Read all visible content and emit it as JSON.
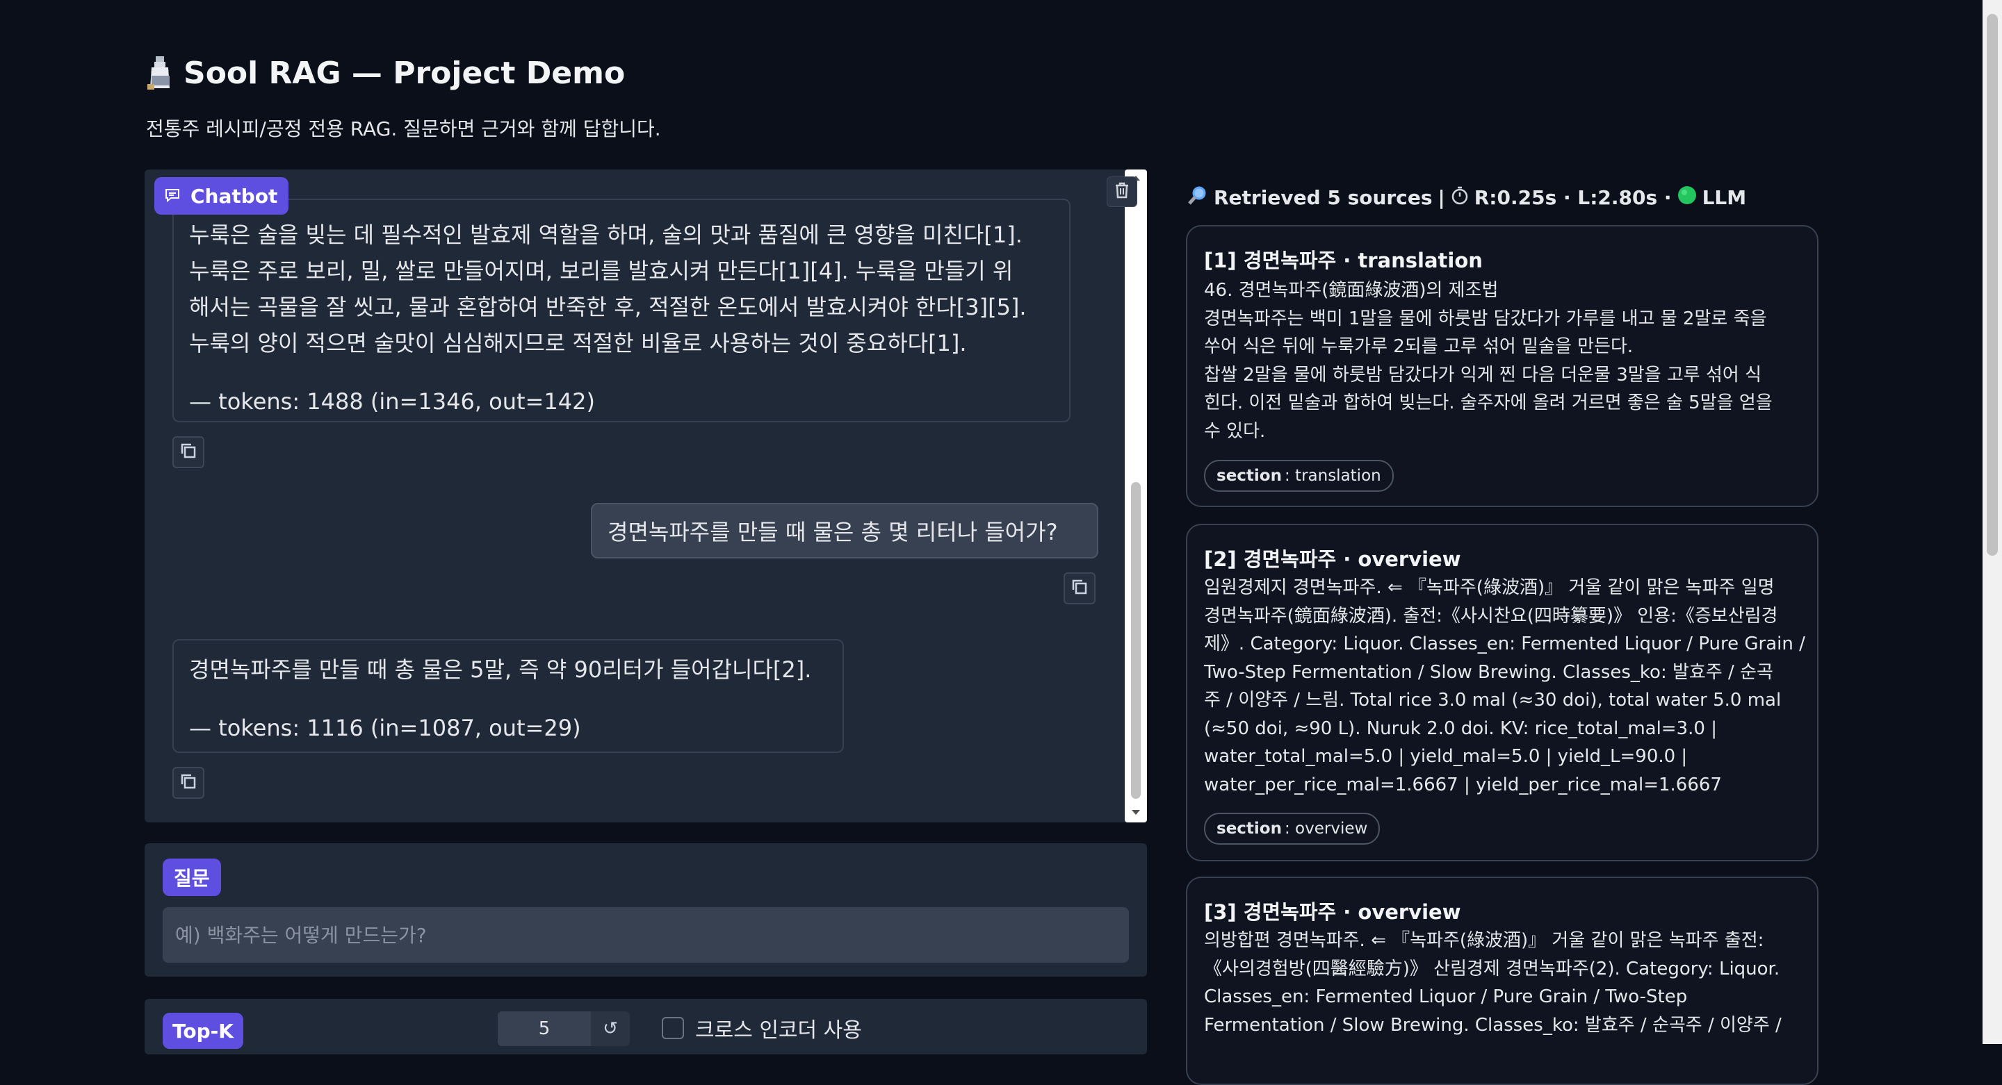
{
  "header": {
    "title": "Sool RAG — Project Demo",
    "subtitle": "전통주 레시피/공정 전용 RAG. 질문하면 근거와 함께 답합니다."
  },
  "chat": {
    "label": "Chatbot",
    "messages": [
      {
        "role": "assistant",
        "lines": [
          "누룩은 술을 빚는 데 필수적인 발효제 역할을 하며, 술의 맛과 품질에 큰 영향을 미친다[1].",
          "누룩은 주로 보리, 밀, 쌀로 만들어지며, 보리를 발효시켜 만든다[1][4]. 누룩을 만들기 위",
          "해서는 곡물을 잘 씻고, 물과 혼합하여 반죽한 후, 적절한 온도에서 발효시켜야 한다[3][5].",
          "누룩의 양이 적으면 술맛이 심심해지므로 적절한 비율로 사용하는 것이 중요하다[1]."
        ],
        "tokens": "— tokens: 1488 (in=1346, out=142)"
      },
      {
        "role": "user",
        "text": "경면녹파주를 만들 때 물은 총 몇 리터나 들어가?"
      },
      {
        "role": "assistant",
        "lines": [
          "경면녹파주를 만들 때 총 물은 5말, 즉 약 90리터가 들어갑니다[2]."
        ],
        "tokens": "— tokens: 1116 (in=1087, out=29)"
      }
    ]
  },
  "question": {
    "label": "질문",
    "placeholder": "예) 백화주는 어떻게 만드는가?"
  },
  "topk": {
    "label": "Top-K",
    "value": "5",
    "reset_icon": "↺",
    "cross_encoder_label": "크로스 인코더 사용"
  },
  "sources": {
    "header_main": "Retrieved 5 sources",
    "header_sep": "|",
    "header_timing": "R:0.25s · L:2.80s ·",
    "header_llm": "LLM",
    "status_color": "#22c55e",
    "cards": [
      {
        "title": "[1] 경면녹파주 · translation",
        "lines": [
          "46. 경면녹파주(鏡面綠波酒)의 제조법",
          "경면녹파주는 백미 1말을 물에 하룻밤 담갔다가 가루를 내고 물 2말로 죽을",
          "쑤어 식은 뒤에 누룩가루 2되를 고루 섞어 밑술을 만든다.",
          "찹쌀 2말을 물에 하룻밤 담갔다가 익게 찐 다음 더운물 3말을 고루 섞어 식",
          "힌다. 이전 밑술과 합하여 빚는다. 술주자에 올려 거르면 좋은 술 5말을 얻을",
          "수 있다."
        ],
        "chip_key": "section",
        "chip_value": ": translation"
      },
      {
        "title": "[2] 경면녹파주 · overview",
        "lines": [
          "임원경제지 경면녹파주. ⇐ 『녹파주(綠波酒)』 거울 같이 맑은 녹파주 일명",
          "경면녹파주(鏡面綠波酒). 출전:《사시찬요(四時纂要)》 인용:《증보산림경",
          "제》. Category: Liquor. Classes_en: Fermented Liquor / Pure Grain /",
          "Two-Step Fermentation / Slow Brewing. Classes_ko: 발효주 / 순곡",
          "주 / 이양주 / 느림. Total rice 3.0 mal (≈30 doi), total water 5.0 mal",
          "(≈50 doi, ≈90 L). Nuruk 2.0 doi. KV: rice_total_mal=3.0 |",
          "water_total_mal=5.0 | yield_mal=5.0 | yield_L=90.0 |",
          "water_per_rice_mal=1.6667 | yield_per_rice_mal=1.6667"
        ],
        "chip_key": "section",
        "chip_value": ": overview"
      },
      {
        "title": "[3] 경면녹파주 · overview",
        "lines": [
          "의방합편 경면녹파주. ⇐ 『녹파주(綠波酒)』 거울 같이 맑은 녹파주 출전:",
          "《사의경험방(四醫經驗方)》 산림경제 경면녹파주(2). Category: Liquor.",
          "Classes_en: Fermented Liquor / Pure Grain / Two-Step",
          "Fermentation / Slow Brewing. Classes_ko: 발효주 / 순곡주 / 이양주 /"
        ]
      }
    ]
  }
}
